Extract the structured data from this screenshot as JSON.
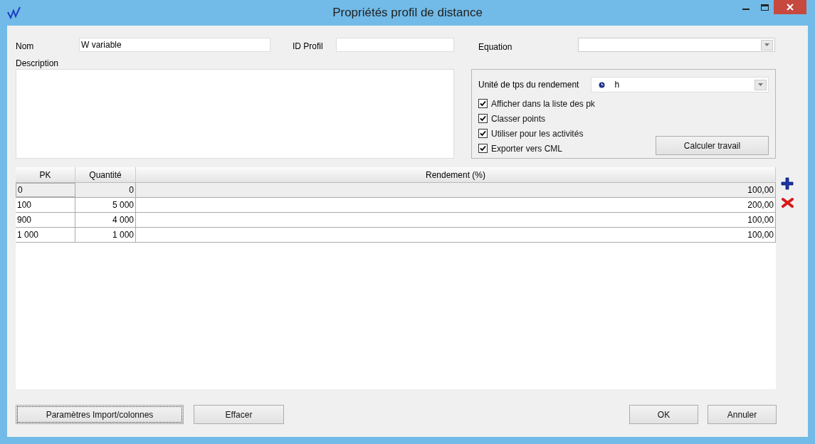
{
  "window": {
    "title": "Propriétés profil de distance"
  },
  "fields": {
    "name": {
      "label": "Nom",
      "value": "W variable"
    },
    "id_profile": {
      "label": "ID Profil"
    },
    "equation": {
      "label": "Equation"
    },
    "description": {
      "label": "Description"
    }
  },
  "options": {
    "time_unit": {
      "label": "Unité de tps du rendement",
      "value": "h"
    },
    "checkboxes": [
      {
        "label": "Afficher dans la liste des pk",
        "checked": true
      },
      {
        "label": "Classer points",
        "checked": true
      },
      {
        "label": "Utiliser pour les activités",
        "checked": true
      },
      {
        "label": "Exporter vers CML",
        "checked": true
      }
    ],
    "button": "Calculer travail"
  },
  "table": {
    "columns": [
      "PK",
      "Quantité",
      "Rendement (%)"
    ],
    "rows": [
      {
        "cells": [
          "0",
          "0",
          "100,00"
        ],
        "selected": true
      },
      {
        "cells": [
          "100",
          "5 000",
          "200,00"
        ],
        "selected": false
      },
      {
        "cells": [
          "900",
          "4 000",
          "100,00"
        ],
        "selected": false
      },
      {
        "cells": [
          "1 000",
          "1 000",
          "100,00"
        ],
        "selected": false
      }
    ]
  },
  "buttons": {
    "import": "Paramètres Import/colonnes",
    "clear": "Effacer",
    "ok": "OK",
    "cancel": "Annuler"
  }
}
